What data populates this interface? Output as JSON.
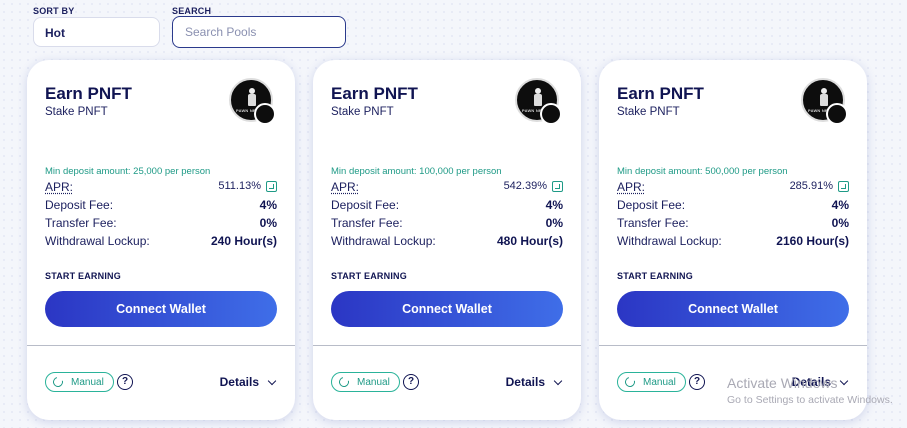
{
  "filters": {
    "sort_by_label": "SORT BY",
    "sort_by_value": "Hot",
    "search_label": "SEARCH",
    "search_placeholder": "Search Pools",
    "search_value": ""
  },
  "pools": [
    {
      "title": "Earn PNFT",
      "subtitle": "Stake PNFT",
      "logo_text": "PAWN NFT",
      "logo_icon": "pawn-icon",
      "min_deposit": "Min deposit amount: 25,000 per person",
      "apr_label": "APR:",
      "apr_value": "511.13%",
      "deposit_fee_label": "Deposit Fee:",
      "deposit_fee_value": "4%",
      "transfer_fee_label": "Transfer Fee:",
      "transfer_fee_value": "0%",
      "lockup_label": "Withdrawal Lockup:",
      "lockup_value": "240 Hour(s)",
      "start_label": "START EARNING",
      "connect_label": "Connect Wallet",
      "manual_label": "Manual",
      "help_label": "?",
      "details_label": "Details"
    },
    {
      "title": "Earn PNFT",
      "subtitle": "Stake PNFT",
      "logo_text": "PAWN NFT",
      "logo_icon": "pawn-icon",
      "min_deposit": "Min deposit amount: 100,000 per person",
      "apr_label": "APR:",
      "apr_value": "542.39%",
      "deposit_fee_label": "Deposit Fee:",
      "deposit_fee_value": "4%",
      "transfer_fee_label": "Transfer Fee:",
      "transfer_fee_value": "0%",
      "lockup_label": "Withdrawal Lockup:",
      "lockup_value": "480 Hour(s)",
      "start_label": "START EARNING",
      "connect_label": "Connect Wallet",
      "manual_label": "Manual",
      "help_label": "?",
      "details_label": "Details"
    },
    {
      "title": "Earn PNFT",
      "subtitle": "Stake PNFT",
      "logo_text": "PAWN NFT",
      "logo_icon": "pawn-icon",
      "min_deposit": "Min deposit amount: 500,000 per person",
      "apr_label": "APR:",
      "apr_value": "285.91%",
      "deposit_fee_label": "Deposit Fee:",
      "deposit_fee_value": "4%",
      "transfer_fee_label": "Transfer Fee:",
      "transfer_fee_value": "0%",
      "lockup_label": "Withdrawal Lockup:",
      "lockup_value": "2160 Hour(s)",
      "start_label": "START EARNING",
      "connect_label": "Connect Wallet",
      "manual_label": "Manual",
      "help_label": "?",
      "details_label": "Details"
    }
  ],
  "watermark": {
    "line1": "Activate Windows",
    "line2": "Go to Settings to activate Windows."
  },
  "colors": {
    "accent_teal": "#1e9a86",
    "button_start": "#2b36c4",
    "button_end": "#3f6ee8",
    "text_navy": "#101452"
  }
}
